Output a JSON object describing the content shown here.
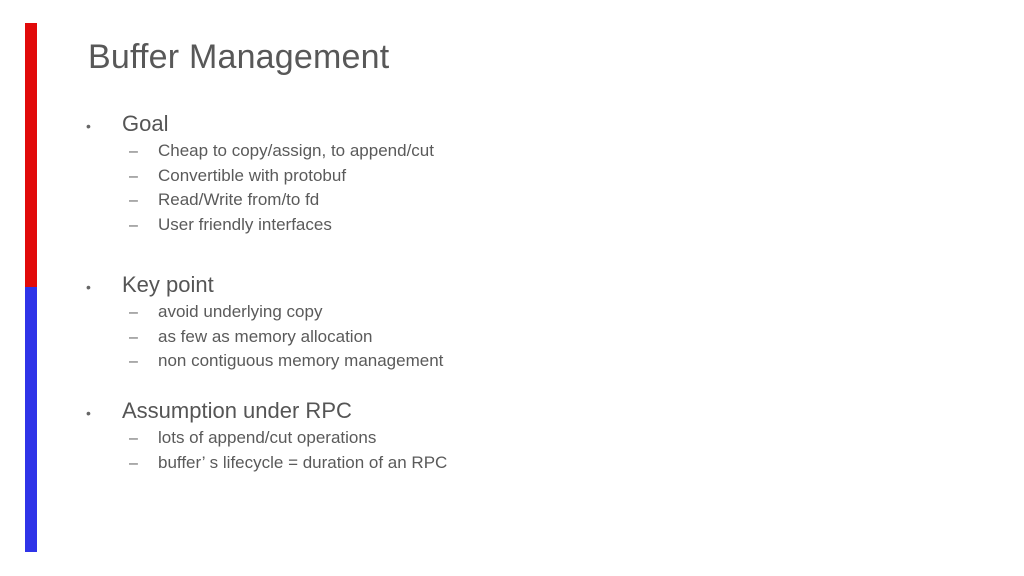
{
  "slide": {
    "title": "Buffer Management",
    "accent_colors": {
      "top": "#e10a0a",
      "bottom": "#2f34e8"
    },
    "bullet_glyph": "•",
    "dash_glyph": "–",
    "sections": [
      {
        "heading": "Goal",
        "items": [
          "Cheap to copy/assign, to append/cut",
          "Convertible with protobuf",
          "Read/Write from/to fd",
          "User friendly interfaces"
        ]
      },
      {
        "heading": "Key point",
        "items": [
          "avoid underlying copy",
          "as few as memory allocation",
          "non contiguous memory management"
        ]
      },
      {
        "heading": "Assumption under RPC",
        "items": [
          "lots of append/cut operations",
          "buffer’ s lifecycle = duration of an RPC"
        ]
      }
    ]
  }
}
